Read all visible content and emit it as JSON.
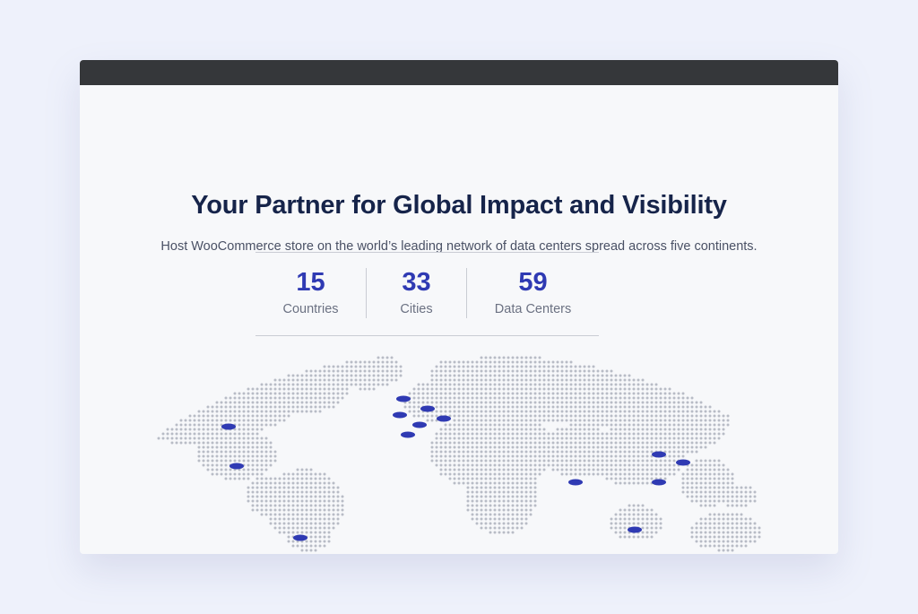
{
  "page": {
    "title": "Your Partner for Global Impact and Visibility",
    "subtitle": "Host WooCommerce store on the world’s leading network of data centers spread across five continents."
  },
  "stats": [
    {
      "value": "15",
      "label": "Countries"
    },
    {
      "value": "33",
      "label": "Cities"
    },
    {
      "value": "59",
      "label": "Data Centers"
    }
  ],
  "map": {
    "dot_color": "#b8bcc6",
    "marker_color": "#2f3ab3",
    "icon": "world-dot-map-icon"
  },
  "colors": {
    "accent": "#2f3ab3",
    "title": "#16244a",
    "titlebar": "#35373a",
    "background": "#eef1fb"
  }
}
